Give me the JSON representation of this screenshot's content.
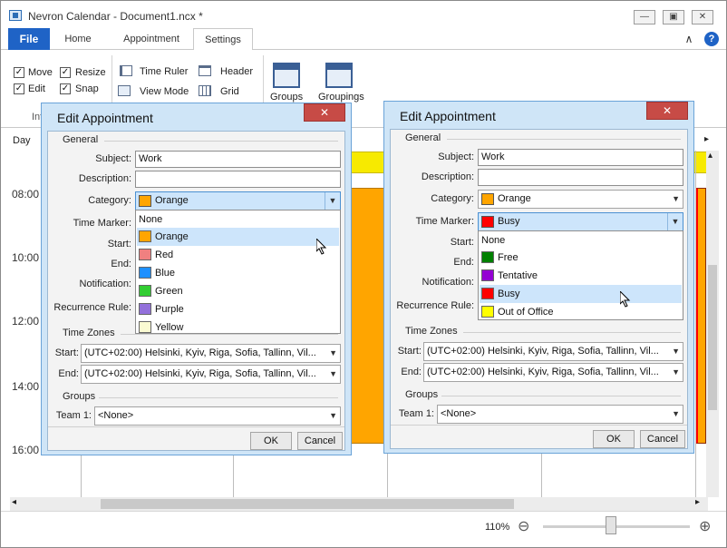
{
  "window": {
    "title": "Nevron Calendar - Document1.ncx *",
    "minimize": "—",
    "restore": "▣",
    "close": "✕"
  },
  "menu": {
    "file": "File",
    "tabs": [
      "Home",
      "Appointment",
      "Settings"
    ],
    "active_tab": "Settings",
    "collapse": "∧",
    "help": "?"
  },
  "ribbon": {
    "move": "Move",
    "resize": "Resize",
    "edit": "Edit",
    "snap": "Snap",
    "time_ruler": "Time Ruler",
    "header": "Header",
    "view_mode": "View Mode",
    "grid": "Grid",
    "groups": "Groups",
    "groupings": "Groupings",
    "group_caption_partial": "Int",
    "check": "✓"
  },
  "calendar": {
    "view_label": "Day",
    "times": [
      "08:00",
      "10:00",
      "12:00",
      "14:00",
      "16:00"
    ],
    "nav_arrow": "▸",
    "appointment_color": "#ffa500",
    "allday_color": "#f7ea00"
  },
  "dialog_left": {
    "title": "Edit Appointment",
    "close": "✕",
    "general": "General",
    "subject_label": "Subject:",
    "subject": "Work",
    "description_label": "Description:",
    "description": "",
    "category_label": "Category:",
    "category": "Orange",
    "category_color": "#ffa500",
    "time_marker_label": "Time Marker:",
    "start_label": "Start:",
    "end_label": "End:",
    "notification_label": "Notification:",
    "recurrence_label": "Recurrence Rule:",
    "dropdown": [
      {
        "label": "None",
        "color": ""
      },
      {
        "label": "Orange",
        "color": "#ffa500",
        "selected": true
      },
      {
        "label": "Red",
        "color": "#f08080"
      },
      {
        "label": "Blue",
        "color": "#1e90ff"
      },
      {
        "label": "Green",
        "color": "#32cd32"
      },
      {
        "label": "Purple",
        "color": "#9370db"
      },
      {
        "label": "Yellow",
        "color": "#fafad2"
      }
    ],
    "time_zones": "Time Zones",
    "tz_start_label": "Start:",
    "tz_start": "(UTC+02:00) Helsinki, Kyiv, Riga, Sofia, Tallinn, Vil...",
    "tz_end_label": "End:",
    "tz_end": "(UTC+02:00) Helsinki, Kyiv, Riga, Sofia, Tallinn, Vil...",
    "groups": "Groups",
    "team_label": "Team 1:",
    "team": "<None>",
    "ok": "OK",
    "cancel": "Cancel"
  },
  "dialog_right": {
    "title": "Edit Appointment",
    "close": "✕",
    "general": "General",
    "subject_label": "Subject:",
    "subject": "Work",
    "description_label": "Description:",
    "description": "",
    "category_label": "Category:",
    "category": "Orange",
    "category_color": "#ffa500",
    "time_marker_label": "Time Marker:",
    "time_marker": "Busy",
    "time_marker_color": "#ff0000",
    "start_label": "Start:",
    "end_label": "End:",
    "notification_label": "Notification:",
    "recurrence_label": "Recurrence Rule:",
    "dropdown": [
      {
        "label": "None",
        "color": ""
      },
      {
        "label": "Free",
        "color": "#008000"
      },
      {
        "label": "Tentative",
        "color": "#9400d3"
      },
      {
        "label": "Busy",
        "color": "#ff0000",
        "selected": true
      },
      {
        "label": "Out of Office",
        "color": "#ffff00"
      }
    ],
    "time_zones": "Time Zones",
    "tz_start_label": "Start:",
    "tz_start": "(UTC+02:00) Helsinki, Kyiv, Riga, Sofia, Tallinn, Vil...",
    "tz_end_label": "End:",
    "tz_end": "(UTC+02:00) Helsinki, Kyiv, Riga, Sofia, Tallinn, Vil...",
    "groups": "Groups",
    "team_label": "Team 1:",
    "team": "<None>",
    "ok": "OK",
    "cancel": "Cancel"
  },
  "statusbar": {
    "zoom": "110%",
    "zoom_out": "⊖",
    "zoom_in": "⊕",
    "zoom_level": 0.46
  },
  "scroll": {
    "left": "◂",
    "right": "▸",
    "up": "▴",
    "down": "▾",
    "dropdown_arrow": "▼"
  }
}
